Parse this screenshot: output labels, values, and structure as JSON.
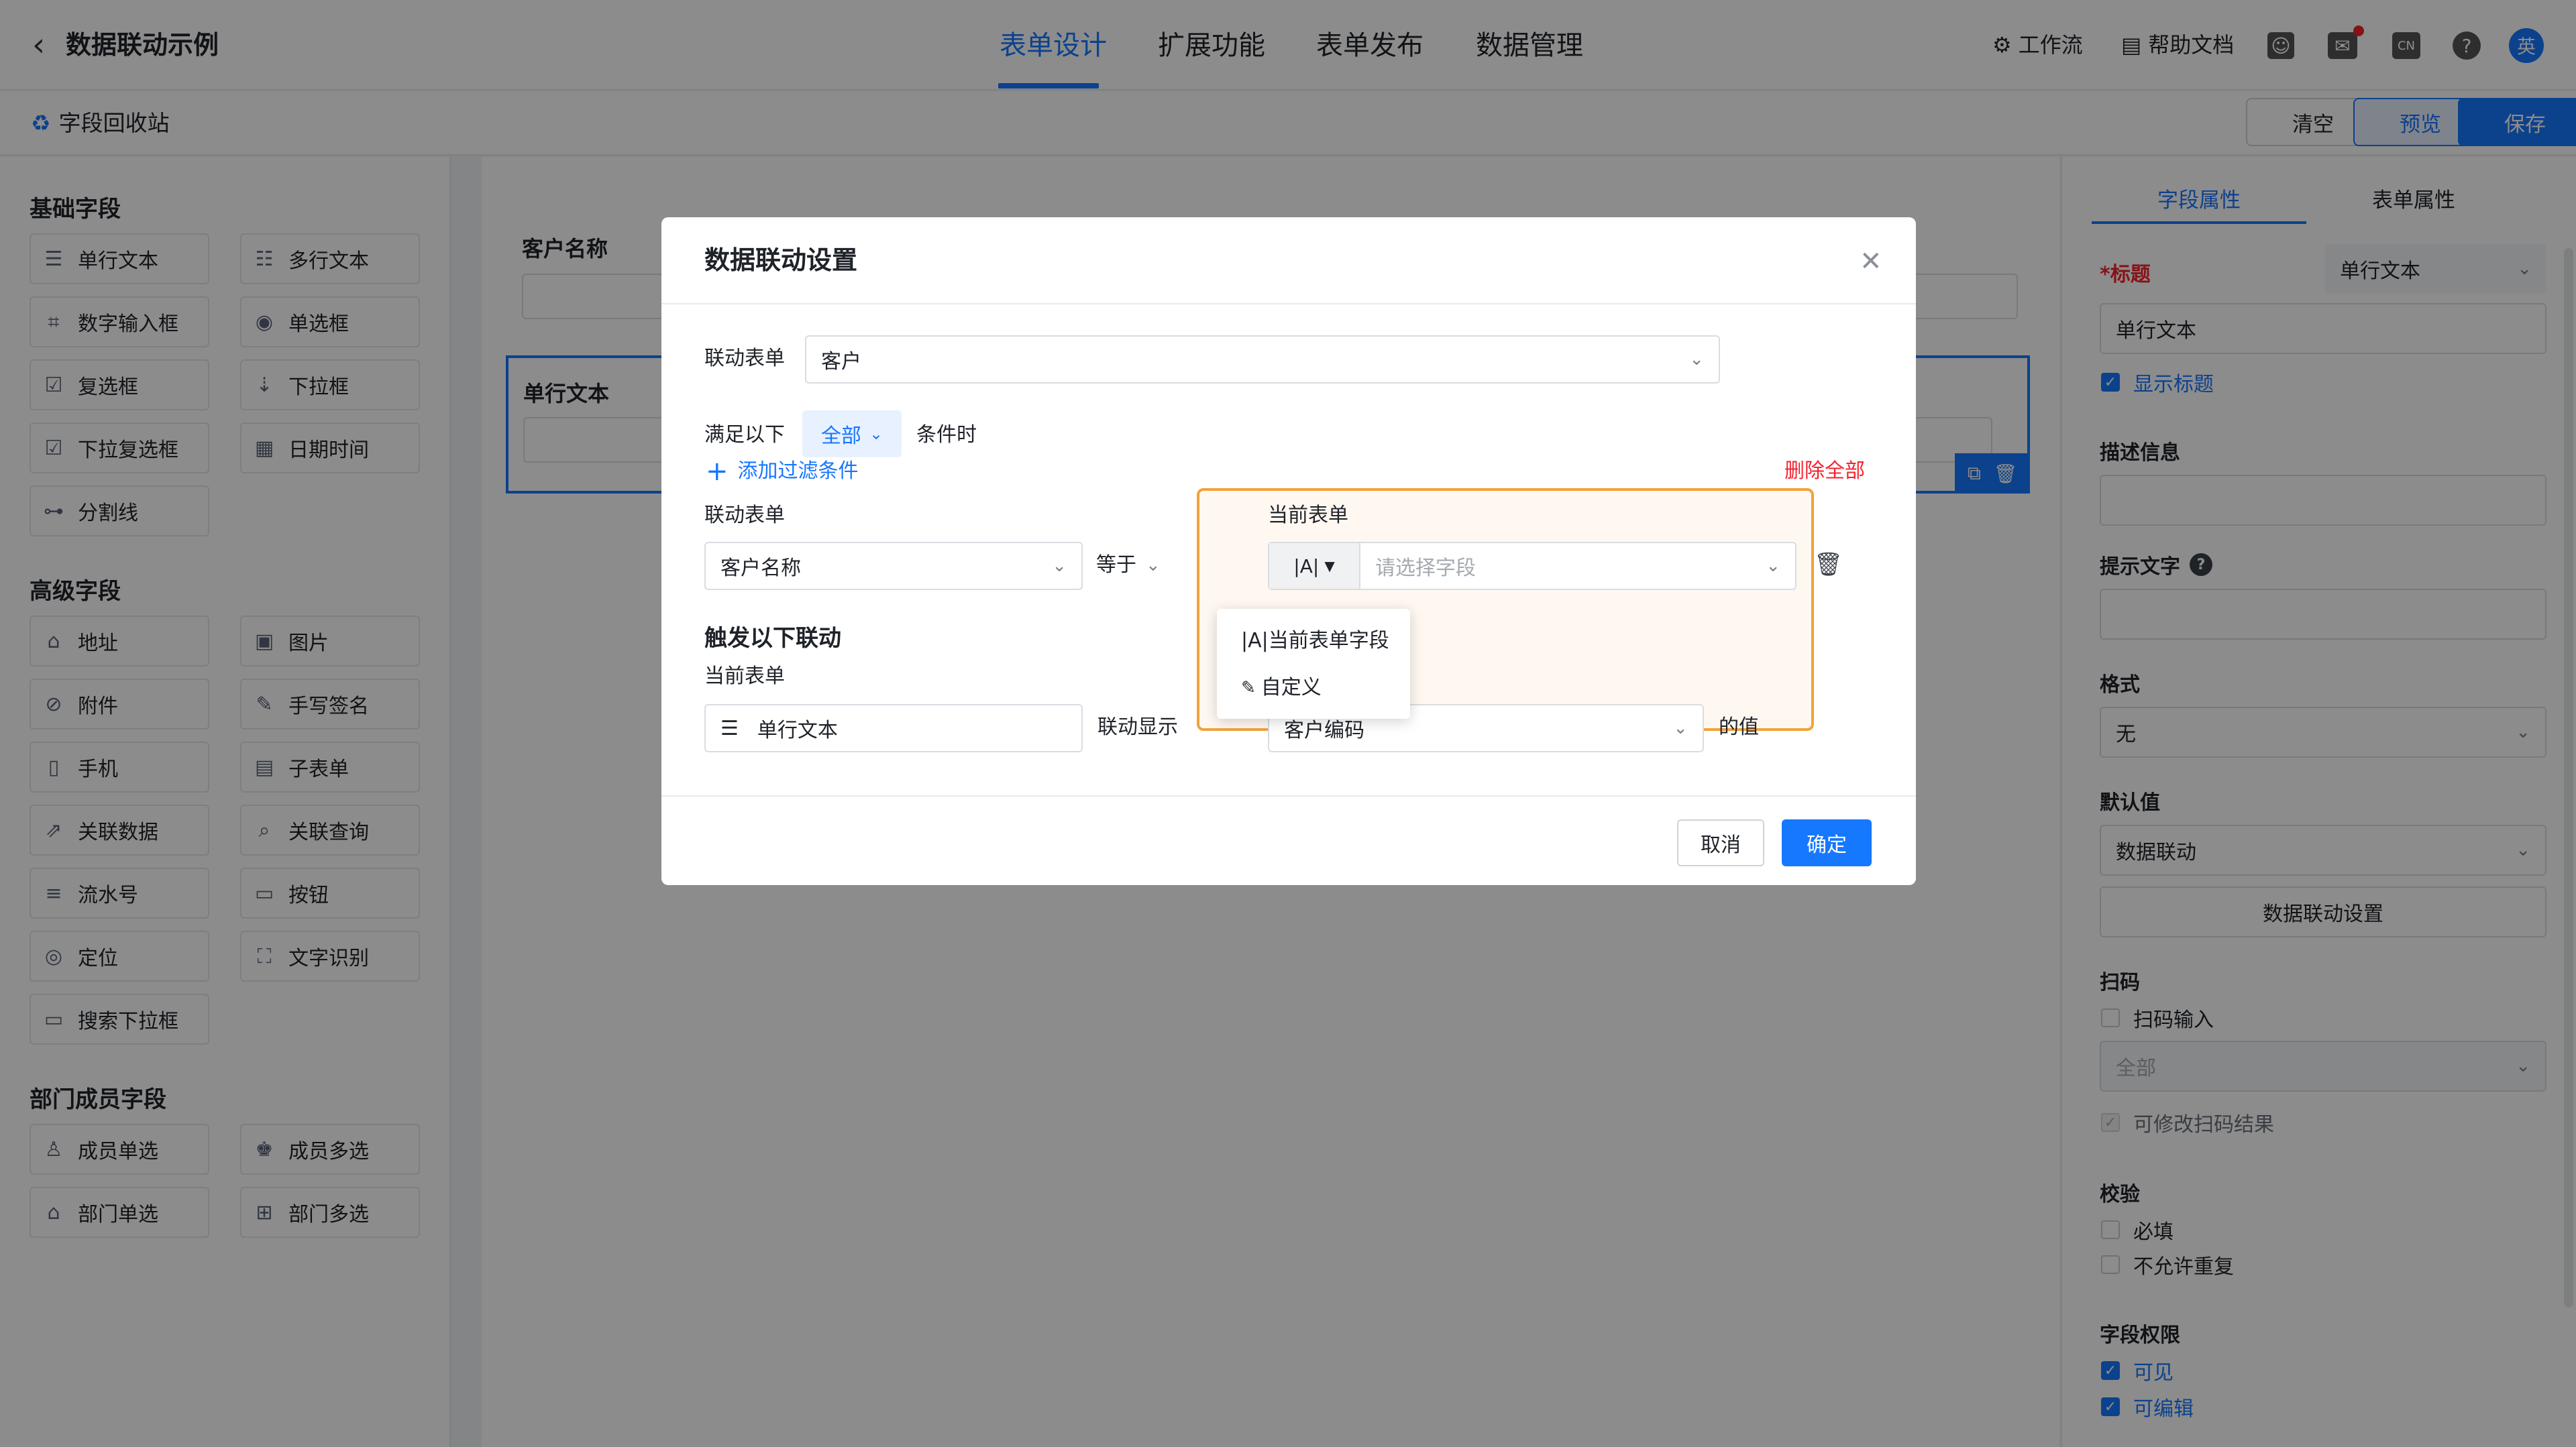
{
  "app": {
    "title": "数据联动示例"
  },
  "nav": {
    "tabs": [
      "表单设计",
      "扩展功能",
      "表单发布",
      "数据管理"
    ],
    "active": "表单设计"
  },
  "header_right": {
    "workflow": "工作流",
    "help_docs": "帮助文档",
    "lang_badge": "CN",
    "help_q": "?",
    "avatar_text": "英"
  },
  "subbar": {
    "recycle": "字段回收站",
    "clear": "清空",
    "preview": "预览",
    "save": "保存"
  },
  "left": {
    "basic_title": "基础字段",
    "basic": [
      {
        "label": "单行文本",
        "icon": "single-line-text-icon",
        "glyph": "☰"
      },
      {
        "label": "多行文本",
        "icon": "multi-line-text-icon",
        "glyph": "☷"
      },
      {
        "label": "数字输入框",
        "icon": "number-input-icon",
        "glyph": "⌗"
      },
      {
        "label": "单选框",
        "icon": "radio-icon",
        "glyph": "◉"
      },
      {
        "label": "复选框",
        "icon": "checkbox-icon",
        "glyph": "☑"
      },
      {
        "label": "下拉框",
        "icon": "dropdown-icon",
        "glyph": "⇣"
      },
      {
        "label": "下拉复选框",
        "icon": "dropdown-checkbox-icon",
        "glyph": "☑"
      },
      {
        "label": "日期时间",
        "icon": "calendar-icon",
        "glyph": "▦"
      },
      {
        "label": "分割线",
        "icon": "divider-icon",
        "glyph": "⊶"
      }
    ],
    "advanced_title": "高级字段",
    "advanced": [
      {
        "label": "地址",
        "icon": "address-icon",
        "glyph": "⌂"
      },
      {
        "label": "图片",
        "icon": "image-icon",
        "glyph": "▣"
      },
      {
        "label": "附件",
        "icon": "attachment-icon",
        "glyph": "⊘"
      },
      {
        "label": "手写签名",
        "icon": "signature-icon",
        "glyph": "✎"
      },
      {
        "label": "手机",
        "icon": "phone-icon",
        "glyph": "▯"
      },
      {
        "label": "子表单",
        "icon": "subform-icon",
        "glyph": "▤"
      },
      {
        "label": "关联数据",
        "icon": "linked-data-icon",
        "glyph": "⇗"
      },
      {
        "label": "关联查询",
        "icon": "linked-query-icon",
        "glyph": "⌕"
      },
      {
        "label": "流水号",
        "icon": "serial-number-icon",
        "glyph": "≡"
      },
      {
        "label": "按钮",
        "icon": "button-icon",
        "glyph": "▭"
      },
      {
        "label": "定位",
        "icon": "location-icon",
        "glyph": "◎"
      },
      {
        "label": "文字识别",
        "icon": "ocr-icon",
        "glyph": "⛶"
      },
      {
        "label": "搜索下拉框",
        "icon": "search-dropdown-icon",
        "glyph": "▭"
      }
    ],
    "dept_title": "部门成员字段",
    "dept": [
      {
        "label": "成员单选",
        "icon": "member-single-icon",
        "glyph": "♙"
      },
      {
        "label": "成员多选",
        "icon": "member-multi-icon",
        "glyph": "♚"
      },
      {
        "label": "部门单选",
        "icon": "department-single-icon",
        "glyph": "⌂"
      },
      {
        "label": "部门多选",
        "icon": "department-multi-icon",
        "glyph": "⊞"
      }
    ]
  },
  "canvas": {
    "field1_label": "客户名称",
    "field2_label": "单行文本"
  },
  "right": {
    "tabs": [
      "字段属性",
      "表单属性"
    ],
    "title_label": "*标题",
    "title_type": "单行文本",
    "title_value": "单行文本",
    "show_title": "显示标题",
    "desc_label": "描述信息",
    "hint_label": "提示文字",
    "format_label": "格式",
    "format_value": "无",
    "default_label": "默认值",
    "default_value": "数据联动",
    "linkage_btn": "数据联动设置",
    "scan_label": "扫码",
    "scan_input": "扫码输入",
    "scan_value": "全部",
    "scan_editable": "可修改扫码结果",
    "verify_label": "校验",
    "required": "必填",
    "no_dup": "不允许重复",
    "perm_label": "字段权限",
    "visible": "可见",
    "editable": "可编辑"
  },
  "modal": {
    "title": "数据联动设置",
    "link_form_label": "联动表单",
    "link_form_value": "客户",
    "meet_label": "满足以下",
    "meet_value": "全部",
    "condition_suffix": "条件时",
    "add_filter": "添加过滤条件",
    "delete_all": "删除全部",
    "cond_left_label": "联动表单",
    "cond_left_value": "客户名称",
    "cond_op": "等于",
    "cond_right_label": "当前表单",
    "cond_right_mode": "|A|",
    "cond_right_placeholder": "请选择字段",
    "trigger_title": "触发以下联动",
    "trigger_current_label": "当前表单",
    "trigger_current_value": "单行文本",
    "trigger_action": "联动显示",
    "trigger_value": "客户编码",
    "trigger_suffix": "的值",
    "dropdown_items": [
      "|A|当前表单字段",
      "自定义"
    ],
    "cancel": "取消",
    "ok": "确定"
  },
  "colors": {
    "primary": "#1677ff",
    "danger": "#f5222d",
    "highlight": "#f2a23a"
  }
}
